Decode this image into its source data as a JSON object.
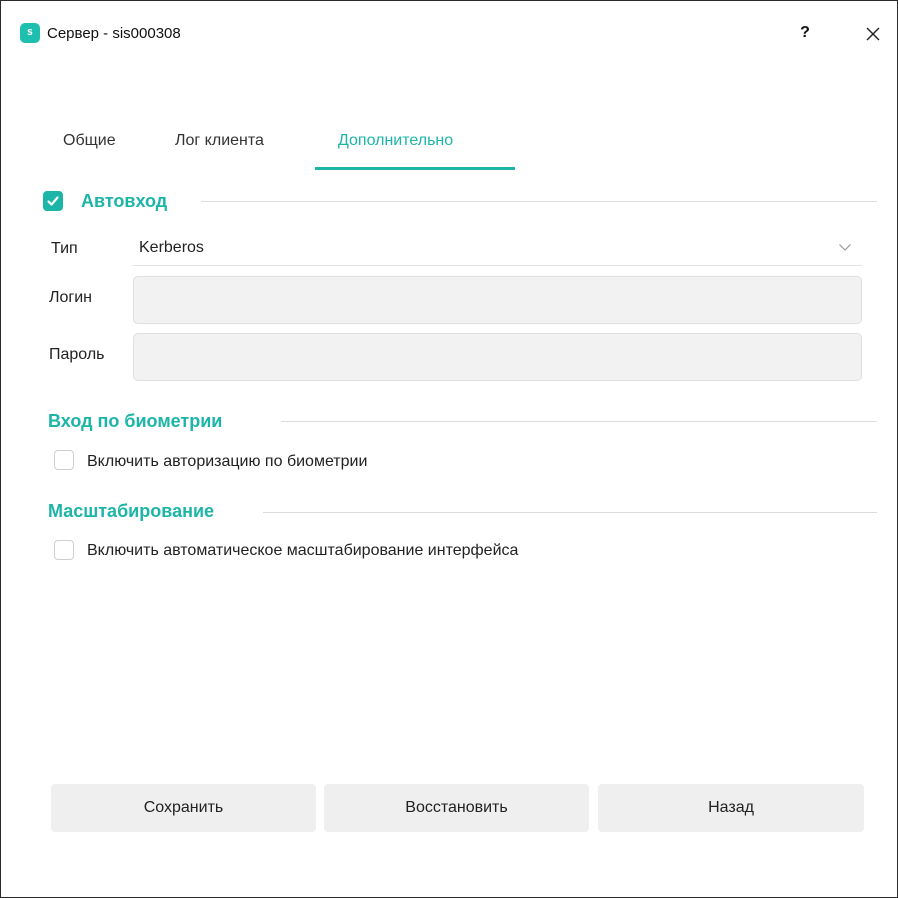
{
  "window": {
    "title": "Сервер - sis000308",
    "help_label": "?"
  },
  "tabs": [
    {
      "label": "Общие",
      "active": false
    },
    {
      "label": "Лог клиента",
      "active": false
    },
    {
      "label": "Дополнительно",
      "active": true
    }
  ],
  "autologin": {
    "title": "Автовход",
    "checked": true,
    "type_label": "Тип",
    "type_value": "Kerberos",
    "login_label": "Логин",
    "login_value": "",
    "password_label": "Пароль",
    "password_value": ""
  },
  "biometrics": {
    "title": "Вход по биометрии",
    "checkbox_label": "Включить авторизацию по биометрии",
    "checked": false
  },
  "scaling": {
    "title": "Масштабирование",
    "checkbox_label": "Включить автоматическое масштабирование интерфейса",
    "checked": false
  },
  "buttons": {
    "save": "Сохранить",
    "restore": "Восстановить",
    "back": "Назад"
  },
  "colors": {
    "accent": "#1cb5a8"
  }
}
